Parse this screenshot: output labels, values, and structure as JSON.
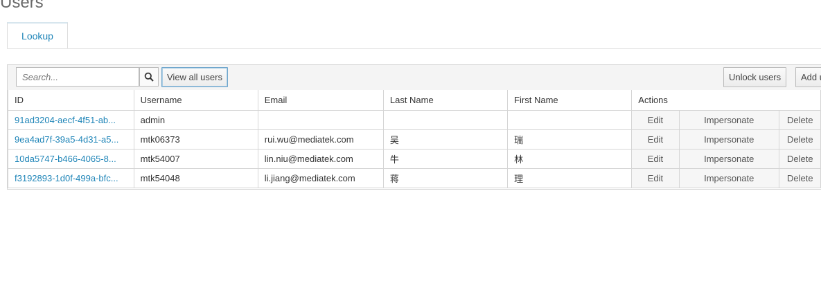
{
  "page": {
    "title": "Users"
  },
  "tabs": [
    {
      "label": "Lookup"
    }
  ],
  "toolbar": {
    "search_placeholder": "Search...",
    "view_all_label": "View all users",
    "unlock_label": "Unlock users",
    "add_label": "Add user"
  },
  "table": {
    "columns": [
      "ID",
      "Username",
      "Email",
      "Last Name",
      "First Name",
      "Actions"
    ],
    "actions": {
      "edit": "Edit",
      "impersonate": "Impersonate",
      "delete": "Delete"
    },
    "rows": [
      {
        "id": "91ad3204-aecf-4f51-ab...",
        "username": "admin",
        "email": "",
        "last_name": "",
        "first_name": ""
      },
      {
        "id": "9ea4ad7f-39a5-4d31-a5...",
        "username": "mtk06373",
        "email": "rui.wu@mediatek.com",
        "last_name": "吴",
        "first_name": "瑞"
      },
      {
        "id": "10da5747-b466-4065-8...",
        "username": "mtk54007",
        "email": "lin.niu@mediatek.com",
        "last_name": "牛",
        "first_name": "林"
      },
      {
        "id": "f3192893-1d0f-499a-bfc...",
        "username": "mtk54048",
        "email": "li.jiang@mediatek.com",
        "last_name": "蒋",
        "first_name": "理"
      }
    ]
  },
  "colors": {
    "link": "#1f85b8",
    "action_bg": "#f6f6f6",
    "border": "#d5d5d5"
  }
}
